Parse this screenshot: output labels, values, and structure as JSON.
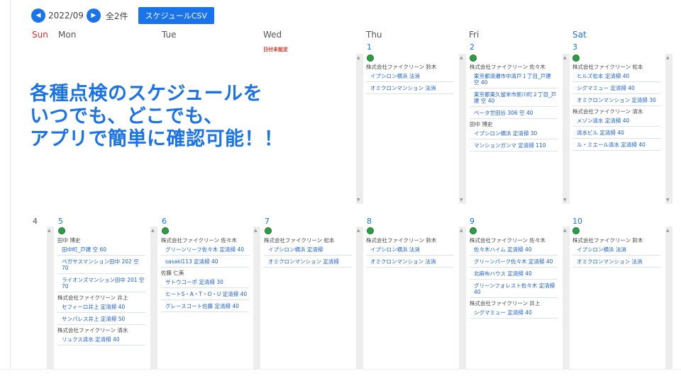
{
  "toolbar": {
    "prev_icon": "chevron-left",
    "next_icon": "chevron-right",
    "month": "2022/09",
    "count": "全2件",
    "csv_label": "スケジュールCSV"
  },
  "weekdays": [
    "Sun",
    "Mon",
    "Tue",
    "Wed",
    "Thu",
    "Fri",
    "Sat"
  ],
  "no_date_label": "日付未設定",
  "promo": {
    "line1": "各種点検のスケジュールを",
    "line2": "いつでも、どこでも、",
    "line3": "アプリで簡単に確認可能！！"
  },
  "week1": [
    {
      "day": "1",
      "groups": [
        {
          "company": "株式会社ファイクリーン 鈴木",
          "items": [
            "イプシロン横浜 法消",
            "オミクロンマンション 法消"
          ]
        }
      ]
    },
    {
      "day": "2",
      "groups": [
        {
          "company": "株式会社ファイクリーン 佐々木",
          "items": [
            "東京都清瀬市中清戸１丁目_戸建 空 40",
            "東京都東久留米市新川町２丁目_戸建 空 40",
            "ベータ世田谷 306 空 40"
          ]
        },
        {
          "company": "田中 博史",
          "items": [
            "イプシロン横浜 定清掃 30",
            "マンションガンマ 定清掃 110"
          ]
        }
      ]
    },
    {
      "day": "3",
      "groups": [
        {
          "company": "株式会社ファイクリーン 松本",
          "items": [
            "ヒルズ松本 定清掃 40",
            "シグマミュー 定清掃 40",
            "オミクロンマンション 定清掃 30"
          ]
        },
        {
          "company": "株式会社ファイクリーン 清水",
          "items": [
            "メゾン清水 定清掃 40",
            "清水ビル 定清掃 40",
            "ル・ミエール清水 定清掃 40"
          ]
        }
      ]
    }
  ],
  "week2": [
    {
      "day": "4"
    },
    {
      "day": "5",
      "groups": [
        {
          "company": "田中 博史",
          "items": [
            "田中町_戸建 空 60",
            "ペガサスマンション田中 202 空 70",
            "ライオンズマンション田中 201 空 70"
          ]
        },
        {
          "company": "株式会社ファイクリーン 井上",
          "items": [
            "セフィーロ井上 定清掃 40",
            "サンパレス井上 定清掃 50"
          ]
        },
        {
          "company": "株式会社ファイクリーン 清水",
          "items": [
            "リュクス清水 定清掃 40"
          ]
        }
      ]
    },
    {
      "day": "6",
      "groups": [
        {
          "company": "株式会社ファイクリーン 佐々木",
          "items": [
            "グリーンリーフ佐々木 定清掃 40",
            "sasaki113 定清掃 40"
          ]
        },
        {
          "company": "佐藤 仁美",
          "items": [
            "サトウコーポ 定清掃 30",
            "ヒートS・A・T・O・U 定清掃 40",
            "グレースコート佐藤 定清掃 40"
          ]
        }
      ]
    },
    {
      "day": "7",
      "groups": [
        {
          "company": "株式会社ファイクリーン 松本",
          "items": [
            "イプシロン横浜 定清掃",
            "オミクロンマンション 定清掃"
          ]
        }
      ]
    },
    {
      "day": "8",
      "groups": [
        {
          "company": "株式会社ファイクリーン 鈴木",
          "items": [
            "イプシロン横浜 法消",
            "オミクロンマンション 法消"
          ]
        }
      ]
    },
    {
      "day": "9",
      "groups": [
        {
          "company": "株式会社ファイクリーン 佐々木",
          "items": [
            "佐々木ハイム 定清掃 40",
            "グリーンパーク佐々木 定清掃 40",
            "北麻布ハウス 定清掃 40",
            "グリーンフォレスト佐々木 定清掃 40"
          ]
        },
        {
          "company": "株式会社ファイクリーン 井上",
          "items": [
            "シグマミュー 定清掃 40"
          ]
        }
      ]
    },
    {
      "day": "10",
      "groups": [
        {
          "company": "株式会社ファイクリーン 鈴木",
          "items": [
            "イプシロン横浜 法消",
            "オミクロンマンション 法消"
          ]
        }
      ]
    }
  ]
}
